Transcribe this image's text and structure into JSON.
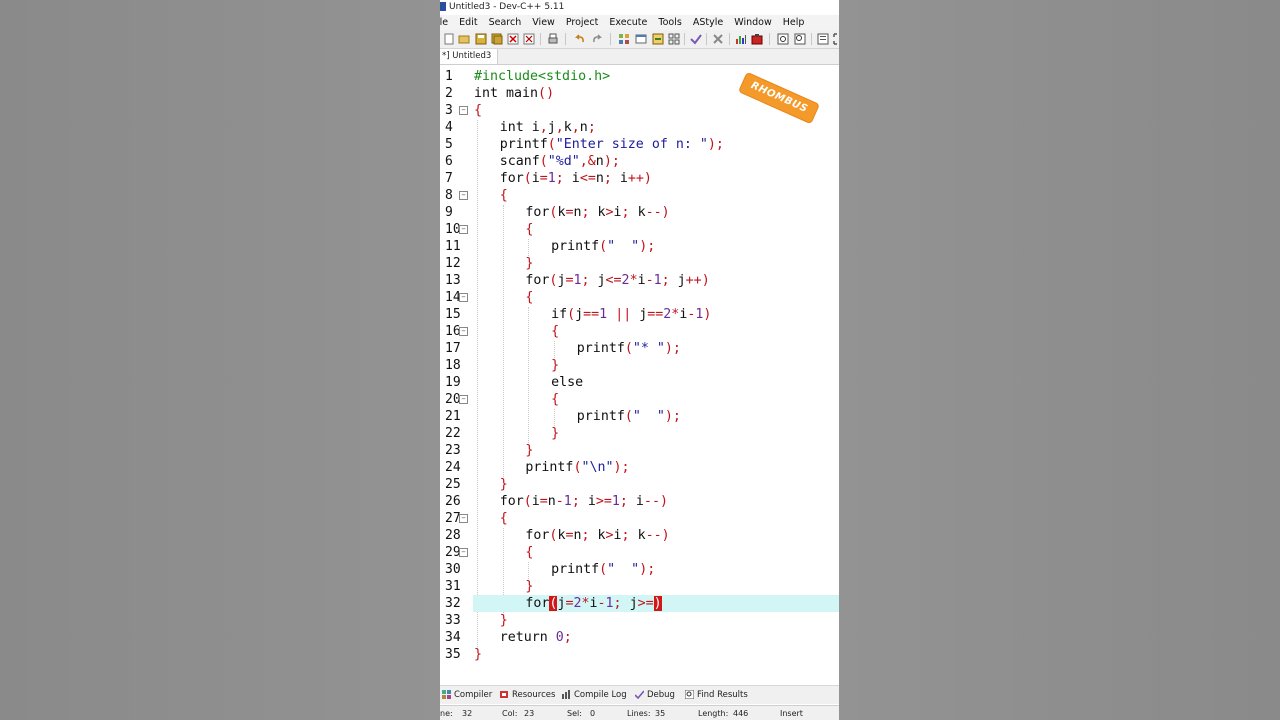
{
  "window": {
    "title": "Untitled3 - Dev-C++ 5.11"
  },
  "menu": [
    "ile",
    "Edit",
    "Search",
    "View",
    "Project",
    "Execute",
    "Tools",
    "AStyle",
    "Window",
    "Help"
  ],
  "tab": {
    "label": "*] Untitled3"
  },
  "logo_text": "RHOMBUS",
  "code_lines": [
    {
      "n": "1",
      "t": "#include<stdio.h>"
    },
    {
      "n": "2",
      "t": "int main()"
    },
    {
      "n": "3",
      "t": "{"
    },
    {
      "n": "4",
      "t": "int i,j,k,n;"
    },
    {
      "n": "5",
      "t": "printf(\"Enter size of n: \");"
    },
    {
      "n": "6",
      "t": "scanf(\"%d\",&n);"
    },
    {
      "n": "7",
      "t": "for(i=1; i<=n; i++)"
    },
    {
      "n": "8",
      "t": "{"
    },
    {
      "n": "9",
      "t": "for(k=n; k>i; k--)"
    },
    {
      "n": "10",
      "t": "{"
    },
    {
      "n": "11",
      "t": "printf(\"  \");"
    },
    {
      "n": "12",
      "t": "}"
    },
    {
      "n": "13",
      "t": "for(j=1; j<=2*i-1; j++)"
    },
    {
      "n": "14",
      "t": "{"
    },
    {
      "n": "15",
      "t": "if(j==1 || j==2*i-1)"
    },
    {
      "n": "16",
      "t": "{"
    },
    {
      "n": "17",
      "t": "printf(\"* \");"
    },
    {
      "n": "18",
      "t": "}"
    },
    {
      "n": "19",
      "t": "else"
    },
    {
      "n": "20",
      "t": "{"
    },
    {
      "n": "21",
      "t": "printf(\"  \");"
    },
    {
      "n": "22",
      "t": "}"
    },
    {
      "n": "23",
      "t": "}"
    },
    {
      "n": "24",
      "t": "printf(\"\\n\");"
    },
    {
      "n": "25",
      "t": "}"
    },
    {
      "n": "26",
      "t": "for(i=n-1; i>=1; i--)"
    },
    {
      "n": "27",
      "t": "{"
    },
    {
      "n": "28",
      "t": "for(k=n; k>i; k--)"
    },
    {
      "n": "29",
      "t": "{"
    },
    {
      "n": "30",
      "t": "printf(\"  \");"
    },
    {
      "n": "31",
      "t": "}"
    },
    {
      "n": "32",
      "t": "for(j=2*i-1; j>=)"
    },
    {
      "n": "33",
      "t": "}"
    },
    {
      "n": "34",
      "t": "return 0;"
    },
    {
      "n": "35",
      "t": "}"
    }
  ],
  "bottom_tabs": [
    "Compiler",
    "Resources",
    "Compile Log",
    "Debug",
    "Find Results"
  ],
  "status": {
    "line_label": "ne:",
    "line_value": "32",
    "col_label": "Col:",
    "col_value": "23",
    "sel_label": "Sel:",
    "sel_value": "0",
    "lines_label": "Lines:",
    "lines_value": "35",
    "length_label": "Length:",
    "length_value": "446",
    "mode": "Insert"
  }
}
